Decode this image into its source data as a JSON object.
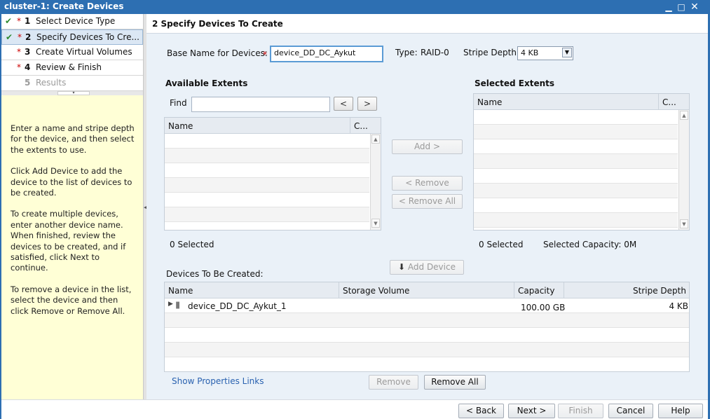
{
  "window": {
    "title": "cluster-1: Create Devices",
    "minimize": "▁",
    "maximize": "□",
    "close": "✕"
  },
  "steps": [
    {
      "check": "✔",
      "required": "*",
      "num": "1",
      "label": "Select Device Type"
    },
    {
      "check": "✔",
      "required": "*",
      "num": "2",
      "label": "Specify Devices To Cre..."
    },
    {
      "check": "",
      "required": "*",
      "num": "3",
      "label": "Create Virtual Volumes"
    },
    {
      "check": "",
      "required": "*",
      "num": "4",
      "label": "Review & Finish"
    },
    {
      "check": "",
      "required": "",
      "num": "5",
      "label": "Results"
    }
  ],
  "help": [
    "Enter a name and stripe depth for the device, and then select the extents to use.",
    "Click Add Device to add the device to the list of devices to be created.",
    "To create multiple devices, enter another device name. When finished, review the devices to be created, and if satisfied, click Next to continue.",
    "To remove a device in the list, select the device and then click Remove or Remove All."
  ],
  "main": {
    "header": "2  Specify Devices To Create",
    "base_name_label": "Base Name for Devices:",
    "base_name_value": "device_DD_DC_Aykut",
    "type_label": "Type:",
    "type_value": "RAID-0",
    "stripe_label": "Stripe Depth:",
    "stripe_value": "4 KB",
    "available_title": "Available Extents",
    "find_label": "Find",
    "find_value": "",
    "prev": "<",
    "next": ">",
    "available_cols": [
      "Name",
      "C..."
    ],
    "available_selected": "0 Selected",
    "selected_title": "Selected Extents",
    "selected_cols": [
      "Name",
      "C..."
    ],
    "selected_count": "0 Selected",
    "selected_capacity": "Selected Capacity: 0M",
    "add_btn": "Add >",
    "remove_btn": "< Remove",
    "remove_all_btn": "< Remove All",
    "add_device_btn": "Add Device",
    "devices_title": "Devices To Be Created:",
    "devices_cols": [
      "Name",
      "Storage Volume",
      "Capacity",
      "Stripe Depth"
    ],
    "devices_rows": [
      {
        "name": "device_DD_DC_Aykut_1",
        "storage_volume": "",
        "capacity": "100.00 GB",
        "stripe_depth": "4 KB"
      }
    ],
    "show_properties_link": "Show Properties Links",
    "remove_device_btn": "Remove",
    "remove_all_devices_btn": "Remove All"
  },
  "footer": {
    "back": "< Back",
    "next": "Next >",
    "finish": "Finish",
    "cancel": "Cancel",
    "help": "Help"
  }
}
